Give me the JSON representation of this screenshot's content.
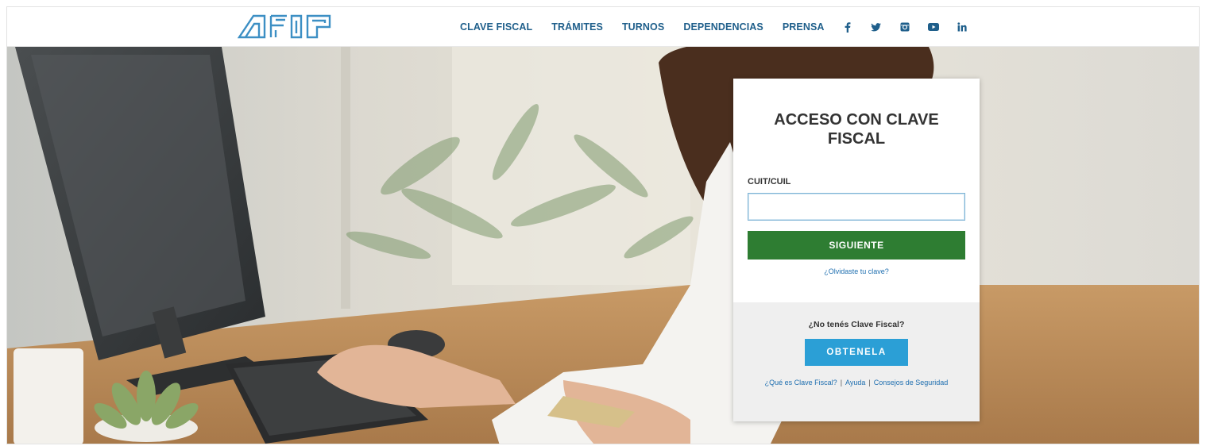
{
  "header": {
    "logo_text": "AFIP",
    "nav": [
      "CLAVE FISCAL",
      "TRÁMITES",
      "TURNOS",
      "DEPENDENCIAS",
      "PRENSA"
    ],
    "social": [
      "facebook-icon",
      "twitter-icon",
      "instagram-icon",
      "youtube-icon",
      "linkedin-icon"
    ],
    "nav_color": "#1f5f8b"
  },
  "login": {
    "title": "ACCESO CON CLAVE FISCAL",
    "field_label": "CUIT/CUIL",
    "field_value": "",
    "next_label": "SIGUIENTE",
    "forgot_label": "¿Olvidaste tu clave?",
    "no_clave_label": "¿No tenés Clave Fiscal?",
    "get_label": "OBTENELA",
    "links": {
      "what": "¿Qué es Clave Fiscal?",
      "help": "Ayuda",
      "security": "Consejos de Seguridad"
    },
    "colors": {
      "next_button": "#2e7d32",
      "get_button": "#2b9fd6",
      "link": "#1f6fb0"
    }
  }
}
